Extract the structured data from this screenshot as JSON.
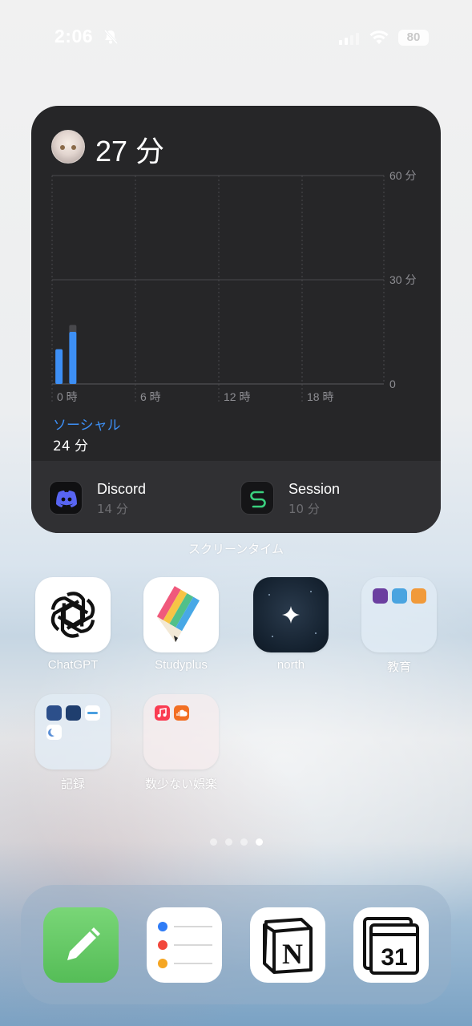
{
  "status_bar": {
    "time": "2:06",
    "battery": "80",
    "icons": [
      "bell-slash-icon",
      "cellular-signal-icon",
      "wifi-icon",
      "battery-icon"
    ]
  },
  "screen_time_widget": {
    "total": "27 分",
    "category": "ソーシャル",
    "category_time": "24 分",
    "caption": "スクリーンタイム",
    "accent_color": "#3d8ff5",
    "apps": [
      {
        "name": "Discord",
        "time": "14 分",
        "icon": "discord-icon"
      },
      {
        "name": "Session",
        "time": "10 分",
        "icon": "session-icon"
      }
    ]
  },
  "chart_data": {
    "type": "bar",
    "x_ticks": [
      "0 時",
      "6 時",
      "12 時",
      "18 時"
    ],
    "y_ticks": [
      "60 分",
      "30 分",
      "0"
    ],
    "ylim": [
      0,
      60
    ],
    "bars": [
      {
        "hour": 1,
        "social": 10,
        "other": 0
      },
      {
        "hour": 2,
        "social": 15,
        "other": 2
      }
    ],
    "colors": {
      "social": "#3d8ff5",
      "other": "#48484c"
    }
  },
  "apps": [
    {
      "name": "ChatGPT",
      "icon": "chatgpt-icon"
    },
    {
      "name": "Studyplus",
      "icon": "studyplus-icon"
    },
    {
      "name": "north",
      "icon": "north-star-icon"
    },
    {
      "name": "教育",
      "icon": "folder-icon"
    },
    {
      "name": "記録",
      "icon": "folder-icon"
    },
    {
      "name": "数少ない娯楽",
      "icon": "folder-icon"
    }
  ],
  "page_indicator": {
    "count": 4,
    "active": 4
  },
  "dock": [
    {
      "name": "notes-pencil",
      "icon": "pencil-icon"
    },
    {
      "name": "reminders",
      "icon": "reminders-icon"
    },
    {
      "name": "notion",
      "icon": "notion-icon",
      "glyph": "N"
    },
    {
      "name": "notion-calendar",
      "icon": "calendar-icon",
      "glyph": "31"
    }
  ]
}
